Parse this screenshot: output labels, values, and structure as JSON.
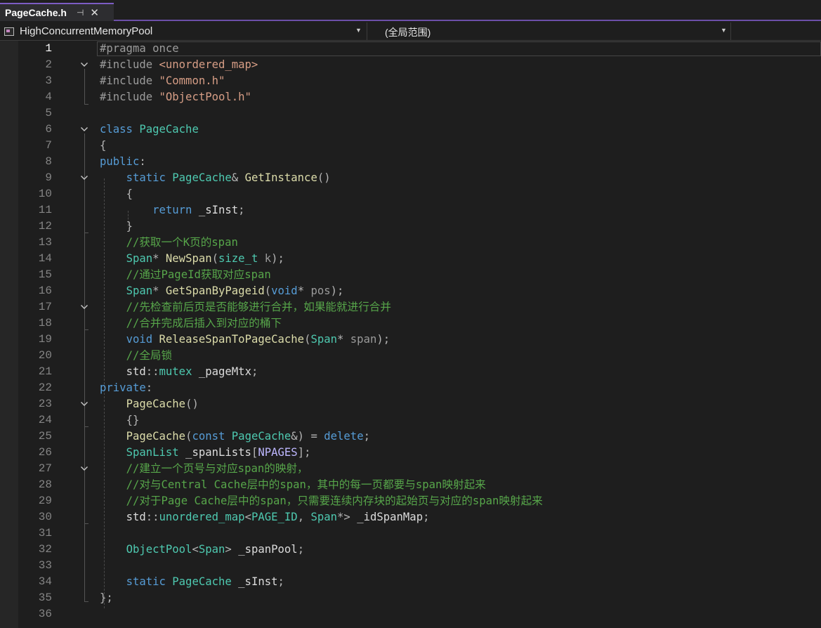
{
  "tab": {
    "filename": "PageCache.h",
    "pin": "⊣",
    "close": "✕"
  },
  "nav": {
    "project": "HighConcurrentMemoryPool",
    "scope": "(全局范围)"
  },
  "colors": {
    "keyword": "#569cd6",
    "type": "#4ec9b0",
    "function": "#dcdcaa",
    "string": "#d69d85",
    "comment": "#57a64a",
    "accent": "#7c5cc4"
  },
  "lines": [
    {
      "n": 1,
      "tokens": [
        [
          "pp",
          "#pragma once"
        ]
      ]
    },
    {
      "n": 2,
      "fold": true,
      "tokens": [
        [
          "pp",
          "#include "
        ],
        [
          "str",
          "<unordered_map>"
        ]
      ]
    },
    {
      "n": 3,
      "tokens": [
        [
          "pp",
          "#include "
        ],
        [
          "str",
          "\"Common.h\""
        ]
      ]
    },
    {
      "n": 4,
      "tokens": [
        [
          "pp",
          "#include "
        ],
        [
          "str",
          "\"ObjectPool.h\""
        ]
      ]
    },
    {
      "n": 5,
      "tokens": []
    },
    {
      "n": 6,
      "fold": true,
      "tokens": [
        [
          "kw",
          "class "
        ],
        [
          "ty",
          "PageCache"
        ]
      ]
    },
    {
      "n": 7,
      "tokens": [
        [
          "op",
          "{"
        ]
      ]
    },
    {
      "n": 8,
      "tokens": [
        [
          "kw",
          "public"
        ],
        [
          "op",
          ":"
        ]
      ]
    },
    {
      "n": 9,
      "fold": true,
      "tokens": [
        [
          "sp",
          "    "
        ],
        [
          "kw",
          "static "
        ],
        [
          "ty",
          "PageCache"
        ],
        [
          "op",
          "& "
        ],
        [
          "fn",
          "GetInstance"
        ],
        [
          "op",
          "()"
        ]
      ]
    },
    {
      "n": 10,
      "tokens": [
        [
          "sp",
          "    "
        ],
        [
          "op",
          "{"
        ]
      ]
    },
    {
      "n": 11,
      "tokens": [
        [
          "sp",
          "        "
        ],
        [
          "kw",
          "return "
        ],
        [
          "id",
          "_sInst"
        ],
        [
          "op",
          ";"
        ]
      ]
    },
    {
      "n": 12,
      "tokens": [
        [
          "sp",
          "    "
        ],
        [
          "op",
          "}"
        ]
      ]
    },
    {
      "n": 13,
      "tokens": [
        [
          "sp",
          "    "
        ],
        [
          "cm",
          "//获取一个K页的span"
        ]
      ]
    },
    {
      "n": 14,
      "tokens": [
        [
          "sp",
          "    "
        ],
        [
          "ty",
          "Span"
        ],
        [
          "op",
          "* "
        ],
        [
          "fn",
          "NewSpan"
        ],
        [
          "op",
          "("
        ],
        [
          "ty",
          "size_t"
        ],
        [
          "par",
          " k"
        ],
        [
          "op",
          ");"
        ]
      ]
    },
    {
      "n": 15,
      "tokens": [
        [
          "sp",
          "    "
        ],
        [
          "cm",
          "//通过PageId获取对应span"
        ]
      ]
    },
    {
      "n": 16,
      "tokens": [
        [
          "sp",
          "    "
        ],
        [
          "ty",
          "Span"
        ],
        [
          "op",
          "* "
        ],
        [
          "fn",
          "GetSpanByPageid"
        ],
        [
          "op",
          "("
        ],
        [
          "kw",
          "void"
        ],
        [
          "op",
          "* "
        ],
        [
          "par",
          "pos"
        ],
        [
          "op",
          ");"
        ]
      ]
    },
    {
      "n": 17,
      "fold": true,
      "tokens": [
        [
          "sp",
          "    "
        ],
        [
          "cm",
          "//先检查前后页是否能够进行合并，如果能就进行合并"
        ]
      ]
    },
    {
      "n": 18,
      "tokens": [
        [
          "sp",
          "    "
        ],
        [
          "cm",
          "//合并完成后插入到对应的桶下"
        ]
      ]
    },
    {
      "n": 19,
      "tokens": [
        [
          "sp",
          "    "
        ],
        [
          "kw",
          "void "
        ],
        [
          "fn",
          "ReleaseSpanToPageCache"
        ],
        [
          "op",
          "("
        ],
        [
          "ty",
          "Span"
        ],
        [
          "op",
          "* "
        ],
        [
          "par",
          "span"
        ],
        [
          "op",
          ");"
        ]
      ]
    },
    {
      "n": 20,
      "tokens": [
        [
          "sp",
          "    "
        ],
        [
          "cm",
          "//全局锁"
        ]
      ]
    },
    {
      "n": 21,
      "tokens": [
        [
          "sp",
          "    "
        ],
        [
          "id",
          "std"
        ],
        [
          "op",
          "::"
        ],
        [
          "ty",
          "mutex"
        ],
        [
          "id",
          " _pageMtx"
        ],
        [
          "op",
          ";"
        ]
      ]
    },
    {
      "n": 22,
      "tokens": [
        [
          "kw",
          "private"
        ],
        [
          "op",
          ":"
        ]
      ]
    },
    {
      "n": 23,
      "fold": true,
      "tokens": [
        [
          "sp",
          "    "
        ],
        [
          "fn",
          "PageCache"
        ],
        [
          "op",
          "()"
        ]
      ]
    },
    {
      "n": 24,
      "tokens": [
        [
          "sp",
          "    "
        ],
        [
          "op",
          "{}"
        ]
      ]
    },
    {
      "n": 25,
      "tokens": [
        [
          "sp",
          "    "
        ],
        [
          "fn",
          "PageCache"
        ],
        [
          "op",
          "("
        ],
        [
          "kw",
          "const "
        ],
        [
          "ty",
          "PageCache"
        ],
        [
          "op",
          "&) = "
        ],
        [
          "kw",
          "delete"
        ],
        [
          "op",
          ";"
        ]
      ]
    },
    {
      "n": 26,
      "tokens": [
        [
          "sp",
          "    "
        ],
        [
          "ty",
          "SpanList"
        ],
        [
          "id",
          " _spanLists"
        ],
        [
          "op",
          "["
        ],
        [
          "mac",
          "NPAGES"
        ],
        [
          "op",
          "];"
        ]
      ]
    },
    {
      "n": 27,
      "fold": true,
      "tokens": [
        [
          "sp",
          "    "
        ],
        [
          "cm",
          "//建立一个页号与对应span的映射，"
        ]
      ]
    },
    {
      "n": 28,
      "tokens": [
        [
          "sp",
          "    "
        ],
        [
          "cm",
          "//对与Central Cache层中的span，其中的每一页都要与span映射起来"
        ]
      ]
    },
    {
      "n": 29,
      "tokens": [
        [
          "sp",
          "    "
        ],
        [
          "cm",
          "//对于Page Cache层中的span，只需要连续内存块的起始页与对应的span映射起来"
        ]
      ]
    },
    {
      "n": 30,
      "tokens": [
        [
          "sp",
          "    "
        ],
        [
          "id",
          "std"
        ],
        [
          "op",
          "::"
        ],
        [
          "ty",
          "unordered_map"
        ],
        [
          "op",
          "<"
        ],
        [
          "ty",
          "PAGE_ID"
        ],
        [
          "op",
          ", "
        ],
        [
          "ty",
          "Span"
        ],
        [
          "op",
          "*> "
        ],
        [
          "id",
          "_idSpanMap"
        ],
        [
          "op",
          ";"
        ]
      ]
    },
    {
      "n": 31,
      "tokens": []
    },
    {
      "n": 32,
      "tokens": [
        [
          "sp",
          "    "
        ],
        [
          "ty",
          "ObjectPool"
        ],
        [
          "op",
          "<"
        ],
        [
          "ty",
          "Span"
        ],
        [
          "op",
          "> "
        ],
        [
          "id",
          "_spanPool"
        ],
        [
          "op",
          ";"
        ]
      ]
    },
    {
      "n": 33,
      "tokens": []
    },
    {
      "n": 34,
      "tokens": [
        [
          "sp",
          "    "
        ],
        [
          "kw",
          "static "
        ],
        [
          "ty",
          "PageCache"
        ],
        [
          "id",
          " _sInst"
        ],
        [
          "op",
          ";"
        ]
      ]
    },
    {
      "n": 35,
      "tokens": [
        [
          "op",
          "};"
        ]
      ]
    },
    {
      "n": 36,
      "tokens": []
    }
  ]
}
